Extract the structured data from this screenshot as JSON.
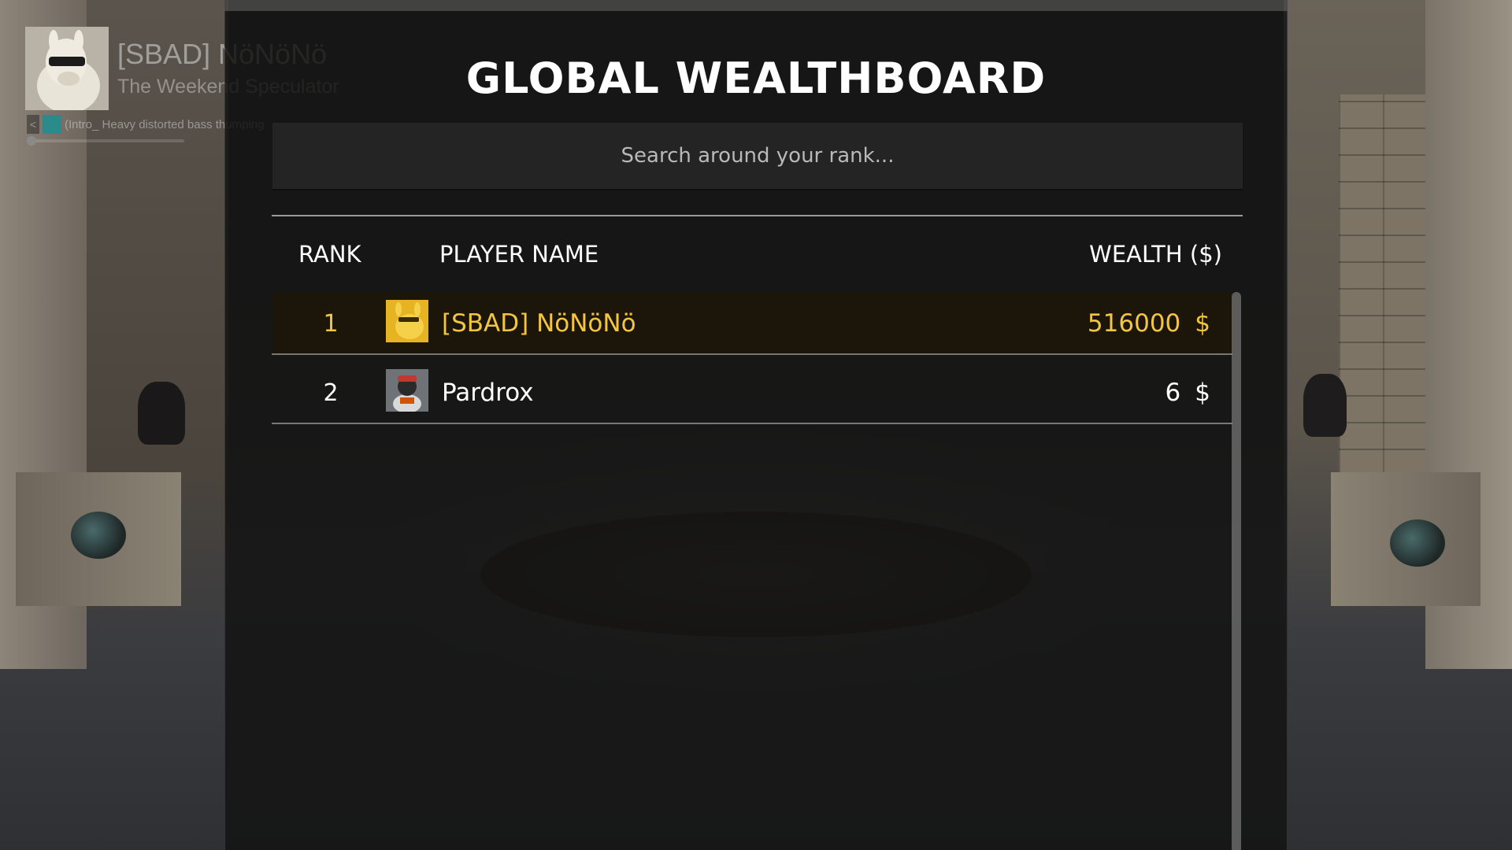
{
  "hud": {
    "player_name": "[SBAD] NöNöNö",
    "player_title": "The Weekend Speculator",
    "music_prev": "<",
    "music_track": "(Intro_ Heavy distorted bass thumping"
  },
  "wealthboard": {
    "title": "GLOBAL WEALTHBOARD",
    "search_placeholder": "Search around your rank...",
    "columns": {
      "rank": "RANK",
      "player_name": "PLAYER NAME",
      "wealth": "WEALTH ($)"
    },
    "rows": [
      {
        "rank": "1",
        "name": "[SBAD] NöNöNö",
        "wealth": "516000",
        "currency": "$",
        "avatar": "llama-avatar-icon",
        "highlighted": true
      },
      {
        "rank": "2",
        "name": "Pardrox",
        "wealth": "6",
        "currency": "$",
        "avatar": "astronaut-avatar-icon",
        "highlighted": false
      }
    ]
  },
  "colors": {
    "highlight": "#f3c641",
    "panel_bg": "#141414",
    "music_accent": "#1d8f8f"
  }
}
